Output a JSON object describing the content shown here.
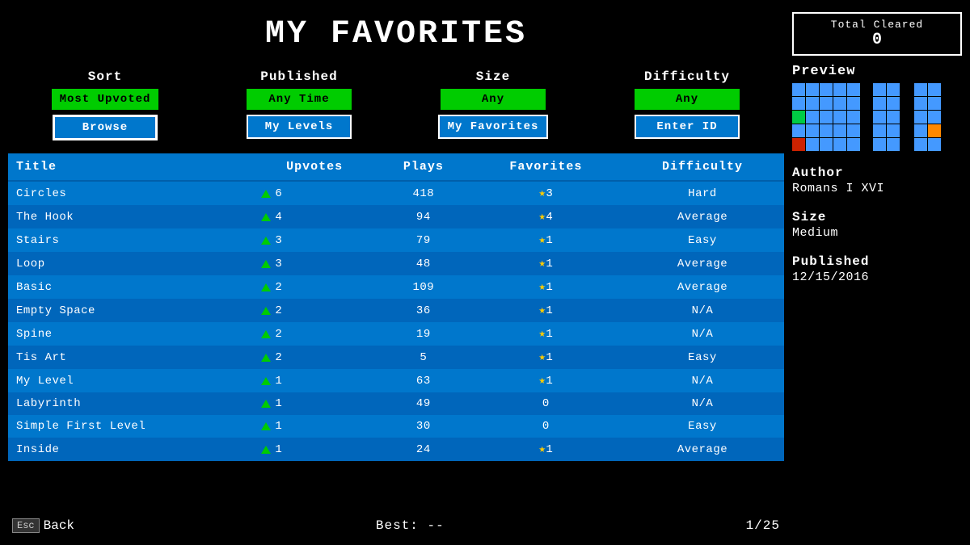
{
  "page": {
    "title": "My FavOritES"
  },
  "filters": {
    "sort_label": "Sort",
    "sort_value": "Most Upvoted",
    "published_label": "Published",
    "published_value": "Any Time",
    "size_label": "Size",
    "size_value": "Any",
    "difficulty_label": "Difficulty",
    "difficulty_value": "Any",
    "browse_label": "Browse",
    "my_levels_label": "My Levels",
    "my_favorites_label": "My Favorites",
    "enter_id_label": "Enter ID"
  },
  "total_cleared": {
    "label": "Total Cleared",
    "value": "0"
  },
  "table": {
    "headers": [
      "Title",
      "Upvotes",
      "Plays",
      "Favorites",
      "Difficulty"
    ],
    "rows": [
      {
        "title": "Circles",
        "upvotes": "6",
        "plays": "418",
        "favorites": "3",
        "fav_type": "star",
        "difficulty": "Hard"
      },
      {
        "title": "The Hook",
        "upvotes": "4",
        "plays": "94",
        "favorites": "4",
        "fav_type": "star",
        "difficulty": "Average"
      },
      {
        "title": "Stairs",
        "upvotes": "3",
        "plays": "79",
        "favorites": "1",
        "fav_type": "star",
        "difficulty": "Easy"
      },
      {
        "title": "Loop",
        "upvotes": "3",
        "plays": "48",
        "favorites": "1",
        "fav_type": "star",
        "difficulty": "Average"
      },
      {
        "title": "Basic",
        "upvotes": "2",
        "plays": "109",
        "favorites": "1",
        "fav_type": "star",
        "difficulty": "Average"
      },
      {
        "title": "Empty Space",
        "upvotes": "2",
        "plays": "36",
        "favorites": "1",
        "fav_type": "star",
        "difficulty": "N/A"
      },
      {
        "title": "Spine",
        "upvotes": "2",
        "plays": "19",
        "favorites": "1",
        "fav_type": "star",
        "difficulty": "N/A"
      },
      {
        "title": "Tis Art",
        "upvotes": "2",
        "plays": "5",
        "favorites": "1",
        "fav_type": "star",
        "difficulty": "Easy"
      },
      {
        "title": "My Level",
        "upvotes": "1",
        "plays": "63",
        "favorites": "1",
        "fav_type": "star",
        "difficulty": "N/A"
      },
      {
        "title": "Labyrinth",
        "upvotes": "1",
        "plays": "49",
        "favorites": "0",
        "fav_type": "num",
        "difficulty": "N/A"
      },
      {
        "title": "Simple First Level",
        "upvotes": "1",
        "plays": "30",
        "favorites": "0",
        "fav_type": "num",
        "difficulty": "Easy"
      },
      {
        "title": "Inside",
        "upvotes": "1",
        "plays": "24",
        "favorites": "1",
        "fav_type": "star",
        "difficulty": "Average"
      }
    ]
  },
  "bottom": {
    "esc_label": "Esc",
    "back_label": "Back",
    "best_label": "Best: --",
    "page_label": "1/25"
  },
  "preview": {
    "label": "Preview"
  },
  "author": {
    "label": "Author",
    "value": "Romans I XVI"
  },
  "size": {
    "label": "Size",
    "value": "Medium"
  },
  "published": {
    "label": "Published",
    "value": "12/15/2016"
  }
}
